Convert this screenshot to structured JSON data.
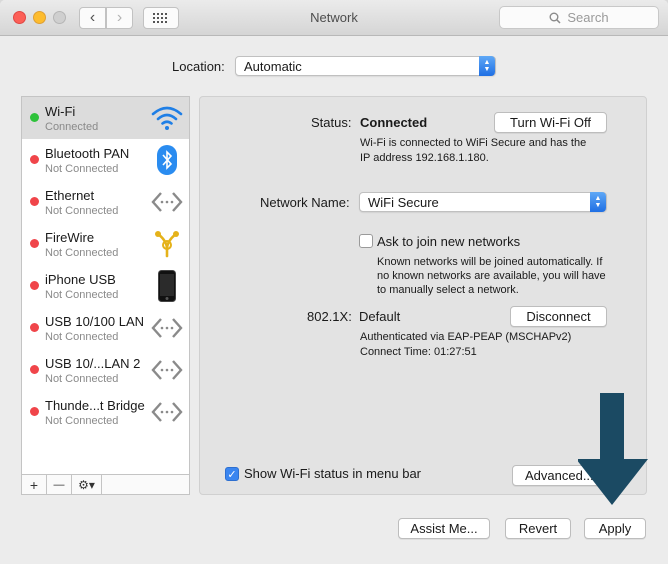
{
  "window": {
    "title": "Network",
    "search_placeholder": "Search"
  },
  "location": {
    "label": "Location:",
    "value": "Automatic"
  },
  "services": [
    {
      "name": "Wi-Fi",
      "status": "Connected",
      "dot": "#2ec23b",
      "icon": "wifi-icon",
      "selected": true
    },
    {
      "name": "Bluetooth PAN",
      "status": "Not Connected",
      "dot": "#f0454a",
      "icon": "bluetooth-icon"
    },
    {
      "name": "Ethernet",
      "status": "Not Connected",
      "dot": "#f0454a",
      "icon": "ethernet-icon"
    },
    {
      "name": "FireWire",
      "status": "Not Connected",
      "dot": "#f0454a",
      "icon": "firewire-icon"
    },
    {
      "name": "iPhone USB",
      "status": "Not Connected",
      "dot": "#f0454a",
      "icon": "iphone-icon"
    },
    {
      "name": "USB 10/100 LAN",
      "status": "Not Connected",
      "dot": "#f0454a",
      "icon": "ethernet-icon"
    },
    {
      "name": "USB 10/...LAN 2",
      "status": "Not Connected",
      "dot": "#f0454a",
      "icon": "ethernet-icon"
    },
    {
      "name": "Thunde...t Bridge",
      "status": "Not Connected",
      "dot": "#f0454a",
      "icon": "ethernet-icon"
    }
  ],
  "sidebar_tools": {
    "add": "+",
    "remove": "—",
    "gear": "⚙▾"
  },
  "detail": {
    "status_label": "Status:",
    "status_value": "Connected",
    "turn_off_button": "Turn Wi-Fi Off",
    "status_desc_1": "Wi-Fi is connected to WiFi Secure and has the",
    "status_desc_2": "IP address 192.168.1.180.",
    "network_name_label": "Network Name:",
    "network_name_value": "WiFi Secure",
    "ask_join_label": "Ask to join new networks",
    "ask_join_desc_1": "Known networks will be joined automatically. If",
    "ask_join_desc_2": "no known networks are available, you will have",
    "ask_join_desc_3": "to manually select a network.",
    "dot1x_label": "802.1X:",
    "dot1x_value": "Default",
    "disconnect_button": "Disconnect",
    "auth_desc": "Authenticated via EAP-PEAP (MSCHAPv2)",
    "connect_time": "Connect Time: 01:27:51",
    "show_status_label": "Show Wi-Fi status in menu bar",
    "advanced_button": "Advanced..."
  },
  "footer": {
    "assist_button": "Assist Me...",
    "revert_button": "Revert",
    "apply_button": "Apply"
  },
  "colors": {
    "arrow": "#1b4a63",
    "accent": "#3b86f0"
  }
}
